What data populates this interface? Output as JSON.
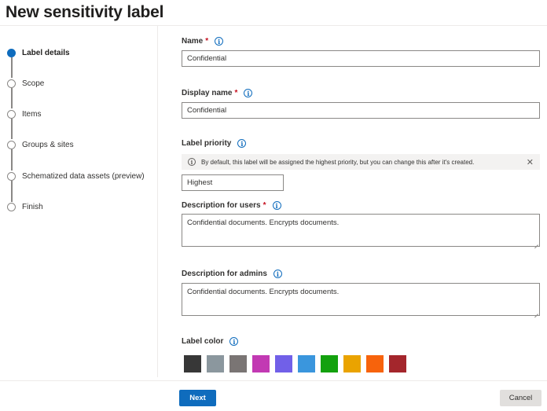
{
  "page": {
    "title": "New sensitivity label"
  },
  "steps": [
    {
      "label": "Label details",
      "active": true
    },
    {
      "label": "Scope",
      "active": false
    },
    {
      "label": "Items",
      "active": false
    },
    {
      "label": "Groups & sites",
      "active": false
    },
    {
      "label": "Schematized data assets (preview)",
      "active": false
    },
    {
      "label": "Finish",
      "active": false
    }
  ],
  "form": {
    "required_mark": "*",
    "info_glyph": "i",
    "name": {
      "label": "Name",
      "value": "Confidential"
    },
    "display_name": {
      "label": "Display name",
      "value": "Confidential"
    },
    "priority": {
      "label": "Label priority",
      "notice": "By default, this label will be assigned the highest priority, but you can change this after it's created.",
      "close_glyph": "✕",
      "value": "Highest"
    },
    "desc_users": {
      "label": "Description for users",
      "value": "Confidential documents. Encrypts documents."
    },
    "desc_admins": {
      "label": "Description for admins",
      "value": "Confidential documents. Encrypts documents."
    },
    "label_color": {
      "label": "Label color",
      "swatches": [
        "#373737",
        "#8b979e",
        "#7a7574",
        "#c239b3",
        "#7160e8",
        "#3a96dd",
        "#13a10e",
        "#eaa300",
        "#f7630c",
        "#a4262c"
      ]
    }
  },
  "footer": {
    "next_label": "Next",
    "cancel_label": "Cancel"
  },
  "colors": {
    "accent": "#0f6cbd",
    "required": "#c50f1f"
  }
}
